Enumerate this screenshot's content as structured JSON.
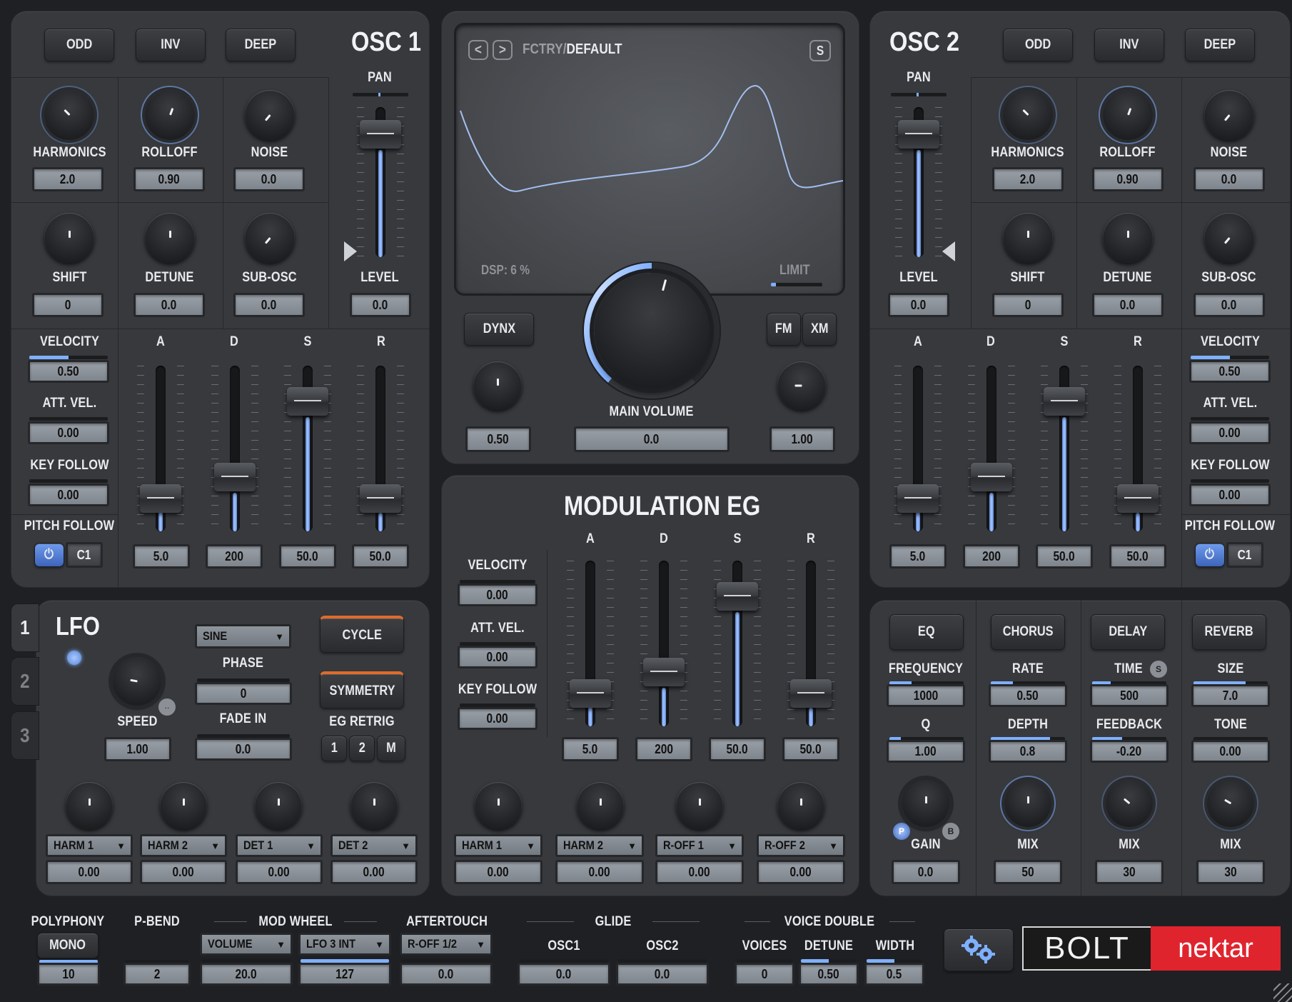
{
  "osc1": {
    "title": "OSC 1",
    "buttons": [
      "ODD",
      "INV",
      "DEEP"
    ],
    "pan_label": "PAN",
    "level_label": "LEVEL",
    "level_value": "0.0",
    "knobs": [
      {
        "label": "HARMONICS",
        "value": "2.0"
      },
      {
        "label": "ROLLOFF",
        "value": "0.90"
      },
      {
        "label": "NOISE",
        "value": "0.0"
      },
      {
        "label": "SHIFT",
        "value": "0"
      },
      {
        "label": "DETUNE",
        "value": "0.0"
      },
      {
        "label": "SUB-OSC",
        "value": "0.0"
      }
    ],
    "velocity": {
      "label": "VELOCITY",
      "value": "0.50"
    },
    "att_vel": {
      "label": "ATT. VEL.",
      "value": "0.00"
    },
    "key_follow": {
      "label": "KEY FOLLOW",
      "value": "0.00"
    },
    "pitch_follow": {
      "label": "PITCH FOLLOW",
      "value": "C1"
    },
    "adsr": [
      {
        "label": "A",
        "value": "5.0"
      },
      {
        "label": "D",
        "value": "200"
      },
      {
        "label": "S",
        "value": "50.0"
      },
      {
        "label": "R",
        "value": "50.0"
      }
    ]
  },
  "osc2": {
    "title": "OSC 2",
    "buttons": [
      "ODD",
      "INV",
      "DEEP"
    ],
    "pan_label": "PAN",
    "level_label": "LEVEL",
    "level_value": "0.0",
    "knobs": [
      {
        "label": "HARMONICS",
        "value": "2.0"
      },
      {
        "label": "ROLLOFF",
        "value": "0.90"
      },
      {
        "label": "NOISE",
        "value": "0.0"
      },
      {
        "label": "SHIFT",
        "value": "0"
      },
      {
        "label": "DETUNE",
        "value": "0.0"
      },
      {
        "label": "SUB-OSC",
        "value": "0.0"
      }
    ],
    "velocity": {
      "label": "VELOCITY",
      "value": "0.50"
    },
    "att_vel": {
      "label": "ATT. VEL.",
      "value": "0.00"
    },
    "key_follow": {
      "label": "KEY FOLLOW",
      "value": "0.00"
    },
    "pitch_follow": {
      "label": "PITCH FOLLOW",
      "value": "C1"
    },
    "adsr": [
      {
        "label": "A",
        "value": "5.0"
      },
      {
        "label": "D",
        "value": "200"
      },
      {
        "label": "S",
        "value": "50.0"
      },
      {
        "label": "R",
        "value": "50.0"
      }
    ]
  },
  "display": {
    "prev": "<",
    "next": ">",
    "preset_folder": "FCTRY/",
    "preset_name": "DEFAULT",
    "save": "S",
    "dsp": "DSP: 6 %",
    "limit": "LIMIT"
  },
  "main": {
    "dynx": "DYNX",
    "fm": "FM",
    "xm": "XM",
    "left_value": "0.50",
    "main_volume_label": "MAIN VOLUME",
    "main_volume_value": "0.0",
    "right_value": "1.00"
  },
  "mod_eg": {
    "title": "MODULATION EG",
    "velocity": {
      "label": "VELOCITY",
      "value": "0.00"
    },
    "att_vel": {
      "label": "ATT. VEL.",
      "value": "0.00"
    },
    "key_follow": {
      "label": "KEY FOLLOW",
      "value": "0.00"
    },
    "adsr": [
      {
        "label": "A",
        "value": "5.0"
      },
      {
        "label": "D",
        "value": "200"
      },
      {
        "label": "S",
        "value": "50.0"
      },
      {
        "label": "R",
        "value": "50.0"
      }
    ],
    "targets": [
      {
        "name": "HARM 1",
        "value": "0.00"
      },
      {
        "name": "HARM 2",
        "value": "0.00"
      },
      {
        "name": "R-OFF 1",
        "value": "0.00"
      },
      {
        "name": "R-OFF 2",
        "value": "0.00"
      }
    ]
  },
  "lfo": {
    "tabs": [
      "1",
      "2",
      "3"
    ],
    "title": "LFO",
    "wave": "SINE",
    "cycle": "CYCLE",
    "phase_label": "PHASE",
    "phase_value": "0",
    "symmetry": "SYMMETRY",
    "speed_label": "SPEED",
    "speed_value": "1.00",
    "fade_label": "FADE IN",
    "fade_value": "0.0",
    "eg_retrig_label": "EG RETRIG",
    "retrig": [
      "1",
      "2",
      "M"
    ],
    "targets": [
      {
        "name": "HARM 1",
        "value": "0.00"
      },
      {
        "name": "HARM 2",
        "value": "0.00"
      },
      {
        "name": "DET 1",
        "value": "0.00"
      },
      {
        "name": "DET 2",
        "value": "0.00"
      }
    ]
  },
  "fx": {
    "buttons": [
      "EQ",
      "CHORUS",
      "DELAY",
      "REVERB"
    ],
    "eq": {
      "frequency_label": "FREQUENCY",
      "frequency": "1000",
      "q_label": "Q",
      "q": "1.00",
      "gain_label": "GAIN",
      "gain": "0.0",
      "p": "P",
      "b": "B"
    },
    "chorus": {
      "rate_label": "RATE",
      "rate": "0.50",
      "depth_label": "DEPTH",
      "depth": "0.8",
      "mix_label": "MIX",
      "mix": "50"
    },
    "delay": {
      "time_label": "TIME",
      "sync": "S",
      "time": "500",
      "feedback_label": "FEEDBACK",
      "feedback": "-0.20",
      "mix_label": "MIX",
      "mix": "30"
    },
    "reverb": {
      "size_label": "SIZE",
      "size": "7.0",
      "tone_label": "TONE",
      "tone": "0.00",
      "mix_label": "MIX",
      "mix": "30"
    }
  },
  "bottom": {
    "polyphony_label": "POLYPHONY",
    "polyphony_mode": "MONO",
    "polyphony_value": "10",
    "pbend_label": "P-BEND",
    "pbend_value": "2",
    "mod_wheel_label": "MOD WHEEL",
    "mod_wheel_target1": "VOLUME",
    "mod_wheel_value1": "20.0",
    "mod_wheel_target2": "LFO 3 INT",
    "mod_wheel_value2": "127",
    "aftertouch_label": "AFTERTOUCH",
    "aftertouch_target": "R-OFF 1/2",
    "aftertouch_value": "0.0",
    "glide_label": "GLIDE",
    "glide_osc1_label": "OSC1",
    "glide_osc1": "0.0",
    "glide_osc2_label": "OSC2",
    "glide_osc2": "0.0",
    "voice_double_label": "VOICE DOUBLE",
    "voices_label": "VOICES",
    "voices": "0",
    "detune_label": "DETUNE",
    "detune": "0.50",
    "width_label": "WIDTH",
    "width": "0.5"
  },
  "brand": {
    "product": "BOLT",
    "maker": "nektar",
    "bolt_color": "#1a1a1a",
    "nektar_color": "#e0242e"
  },
  "colors": {
    "accent": "#7fb0ff",
    "panel": "#37393d",
    "value_bg": "#8d939a"
  }
}
